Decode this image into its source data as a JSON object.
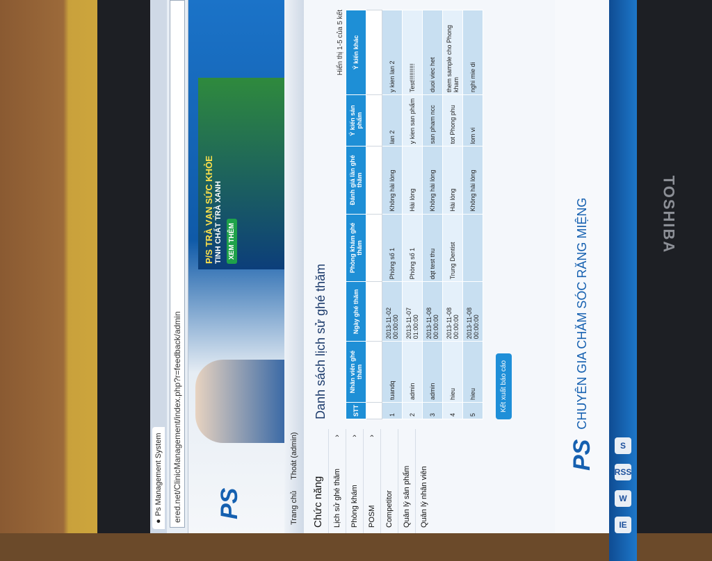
{
  "browser": {
    "tab_title": "Ps Management System",
    "address": "ered.net/ClinicManagement/index.php?r=feedback/admin"
  },
  "banner": {
    "logo": "PS",
    "ad_headline": "P/S TRÀ VẠN SỨC KHỎE",
    "ad_sub": "TINH CHẤT TRÀ XANH",
    "ad_button": "XEM THÊM"
  },
  "nav": {
    "home": "Trang chủ",
    "logout": "Thoát (admin)"
  },
  "sidebar": {
    "title": "Chức năng",
    "items": [
      {
        "label": "Lịch sử ghé thăm"
      },
      {
        "label": "Phòng khám"
      },
      {
        "label": "POSM"
      },
      {
        "label": "Competitor"
      },
      {
        "label": "Quản lý sản phẩm"
      },
      {
        "label": "Quản lý nhân viên"
      }
    ]
  },
  "main": {
    "title": "Danh sách lịch sử ghé thăm",
    "summary": "Hiển thị 1-5 của 5 kết",
    "columns": [
      "STT",
      "Nhân viên ghé thăm",
      "Ngày ghé thăm",
      "Phòng khám ghé thăm",
      "Đánh giá lần ghé thăm",
      "Ý kiến sản phẩm",
      "Ý kiến khác"
    ],
    "rows": [
      [
        "1",
        "tuandq",
        "2013-11-02 00:00:00",
        "Phòng số 1",
        "Không hài lòng",
        "lan 2",
        "y kien lan 2"
      ],
      [
        "2",
        "admin",
        "2013-11-07 01:00:00",
        "Phòng số 1",
        "Hài lòng",
        "y kien san phẩm",
        "Test!!!!!!!!!!"
      ],
      [
        "3",
        "admin",
        "2013-11-08 00:00:00",
        "dqt test thu",
        "Không hài lòng",
        "san pham ncc",
        "duoi viec het"
      ],
      [
        "4",
        "hieu",
        "2013-11-08 00:00:00",
        "Trung Dentist",
        "Hài lòng",
        "tot Phong phu",
        "them sample cho Phong kham"
      ],
      [
        "5",
        "hieu",
        "2013-11-08 00:00:00",
        "",
        "Không hài lòng",
        "lom vi",
        "nghi mie di"
      ]
    ],
    "export_button": "Kết xuất báo cáo"
  },
  "footer": {
    "logo": "PS",
    "slogan": "CHUYÊN GIA CHĂM SÓC RĂNG MIỆNG"
  },
  "taskbar": {
    "icons": [
      "S",
      "RSS",
      "W",
      "IE"
    ]
  },
  "monitor": {
    "brand": "TOSHIBA"
  }
}
